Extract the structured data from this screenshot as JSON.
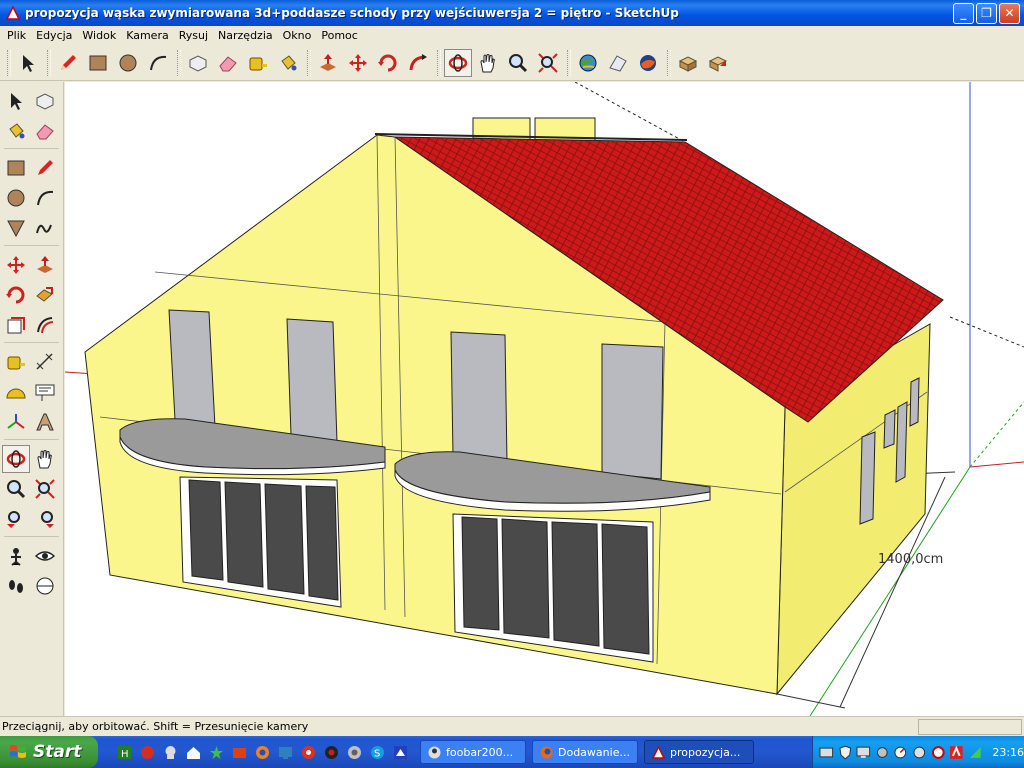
{
  "window": {
    "title": "propozycja wąska zwymiarowana 3d+poddasze schody przy wejściuwersja 2 = piętro - SketchUp",
    "min_label": "_",
    "max_label": "❐",
    "close_label": "✕"
  },
  "menu": [
    {
      "id": "plik",
      "label": "Plik"
    },
    {
      "id": "edycja",
      "label": "Edycja"
    },
    {
      "id": "widok",
      "label": "Widok"
    },
    {
      "id": "kamera",
      "label": "Kamera"
    },
    {
      "id": "rysuj",
      "label": "Rysuj"
    },
    {
      "id": "narzedzia",
      "label": "Narzędzia"
    },
    {
      "id": "okno",
      "label": "Okno"
    },
    {
      "id": "pomoc",
      "label": "Pomoc"
    }
  ],
  "toolbar_tools": [
    "select-icon",
    "pencil-icon",
    "rectangle-icon",
    "circle-icon",
    "arc-icon",
    "make-component-icon",
    "eraser-icon",
    "tape-measure-icon",
    "paint-bucket-icon",
    "push-pull-icon",
    "move-icon",
    "rotate-icon",
    "follow-me-icon",
    "orbit-icon",
    "pan-icon",
    "zoom-icon",
    "zoom-extents-icon",
    "get-models-icon",
    "share-model-icon",
    "google-earth-icon",
    "component-icon",
    "warehouse-icon"
  ],
  "left_tools": [
    "select-icon",
    "make-component-icon",
    "paint-bucket-icon",
    "eraser-icon",
    "rectangle-icon",
    "line-icon",
    "circle-icon",
    "arc-icon",
    "polygon-icon",
    "freehand-icon",
    "move-icon",
    "push-pull-icon",
    "rotate-icon",
    "follow-me-icon",
    "scale-icon",
    "offset-icon",
    "tape-measure-icon",
    "dimension-icon",
    "protractor-icon",
    "text-icon",
    "axes-icon",
    "3d-text-icon",
    "orbit-icon",
    "pan-icon",
    "zoom-icon",
    "zoom-window-icon",
    "previous-view-icon",
    "next-view-icon",
    "position-camera-icon",
    "look-around-icon",
    "walk-icon",
    "section-plane-icon"
  ],
  "viewport": {
    "dimension_label": "1400,0cm",
    "colors": {
      "wall": "#faf68c",
      "roof": "#d01818",
      "window": "#b9b9c0",
      "door": "#4a4a4a"
    }
  },
  "status": {
    "text": "Przeciągnij, aby orbitować. Shift = Przesunięcie kamery"
  },
  "taskbar": {
    "start_label": "Start",
    "tasks": [
      {
        "label": "foobar200...",
        "active": false
      },
      {
        "label": "Dodawanie...",
        "active": false
      },
      {
        "label": "propozycja...",
        "active": true
      }
    ],
    "clock": "23:16"
  }
}
